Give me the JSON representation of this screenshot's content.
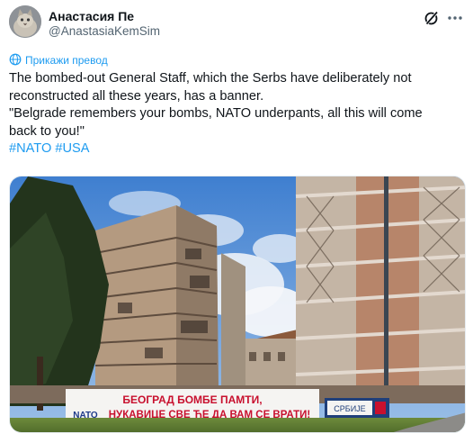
{
  "author": {
    "display_name": "Анастасия Пе",
    "handle": "@AnastasiaKemSim",
    "avatar_icon": "cat-avatar-icon"
  },
  "actions": {
    "grok_icon": "grok-icon",
    "more_icon": "more-dots-icon"
  },
  "translate": {
    "label": "Прикажи превод",
    "icon": "globe-icon"
  },
  "tweet": {
    "lines": [
      "The bombed-out General Staff, which the Serbs have deliberately not",
      "reconstructed all these years, has a banner.",
      "\"Belgrade remembers your bombs, NATO underpants, all this will come",
      "back to you!\""
    ],
    "hashtags": [
      "#NATO",
      "#USA"
    ]
  },
  "media": {
    "banner_line1": "БЕОГРАД БОМБЕ ПАМТИ,",
    "banner_line2_left": "NATO",
    "banner_line2": "НУКАВИЦЕ СВЕ ЋЕ ДА ВАМ СЕ ВРАТИ!",
    "sign_text": "СРБИЈЕ"
  },
  "colors": {
    "accent": "#1d9bf0",
    "text": "#0f1419",
    "muted": "#536471",
    "banner_red": "#c8102e"
  }
}
